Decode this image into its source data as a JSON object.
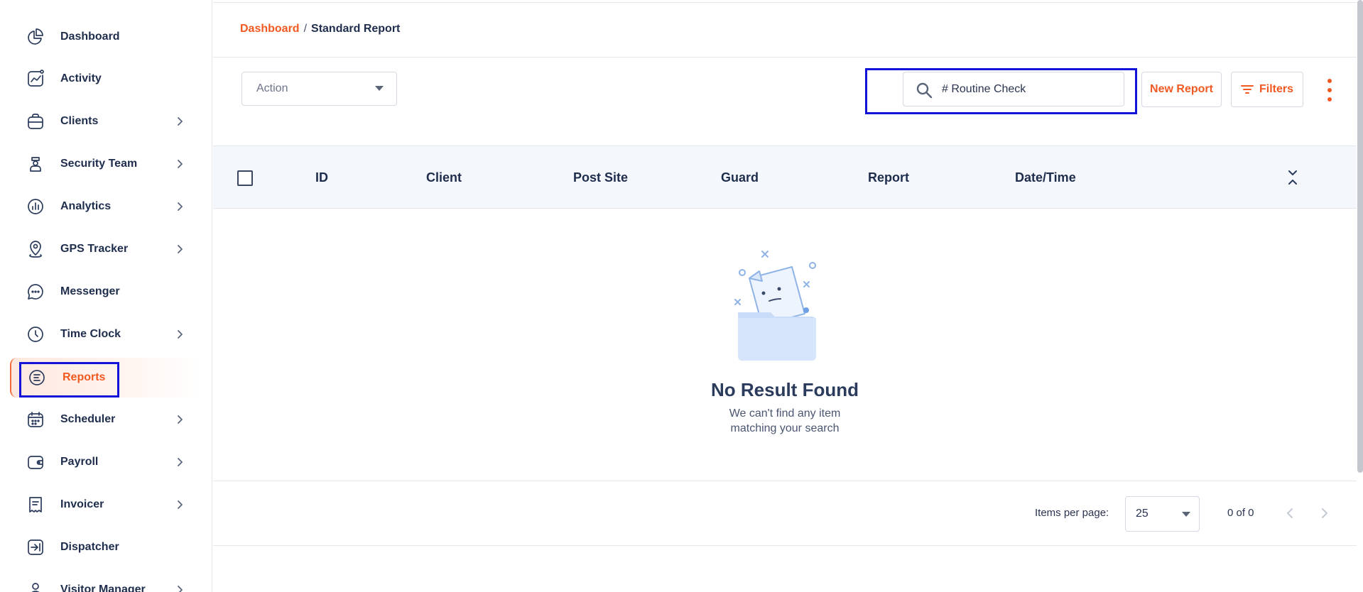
{
  "sidebar": {
    "items": [
      {
        "label": "Dashboard",
        "icon": "pie-chart-icon",
        "has_chevron": false
      },
      {
        "label": "Activity",
        "icon": "activity-icon",
        "has_chevron": false
      },
      {
        "label": "Clients",
        "icon": "briefcase-icon",
        "has_chevron": true
      },
      {
        "label": "Security Team",
        "icon": "guard-icon",
        "has_chevron": true
      },
      {
        "label": "Analytics",
        "icon": "analytics-icon",
        "has_chevron": true
      },
      {
        "label": "GPS Tracker",
        "icon": "map-pin-icon",
        "has_chevron": true
      },
      {
        "label": "Messenger",
        "icon": "chat-bubble-icon",
        "has_chevron": false
      },
      {
        "label": "Time Clock",
        "icon": "clock-icon",
        "has_chevron": true
      },
      {
        "label": "Reports",
        "icon": "report-icon",
        "has_chevron": false,
        "active": true
      },
      {
        "label": "Scheduler",
        "icon": "calendar-icon",
        "has_chevron": true
      },
      {
        "label": "Payroll",
        "icon": "wallet-icon",
        "has_chevron": true
      },
      {
        "label": "Invoicer",
        "icon": "receipt-icon",
        "has_chevron": true
      },
      {
        "label": "Dispatcher",
        "icon": "dispatch-icon",
        "has_chevron": false
      },
      {
        "label": "Visitor Manager",
        "icon": "visitor-icon",
        "has_chevron": true
      }
    ]
  },
  "breadcrumb": {
    "root": "Dashboard",
    "separator": "/",
    "current": "Standard Report"
  },
  "toolbar": {
    "action_placeholder": "Action",
    "search_value": "# Routine Check",
    "new_report_label": "New Report",
    "filters_label": "Filters"
  },
  "table": {
    "columns": [
      "ID",
      "Client",
      "Post Site",
      "Guard",
      "Report",
      "Date/Time"
    ],
    "rows": []
  },
  "empty_state": {
    "title": "No Result Found",
    "subtitle_line1": "We can't find any item",
    "subtitle_line2": "matching your search"
  },
  "pagination": {
    "items_per_page_label": "Items per page:",
    "items_per_page_value": "25",
    "range": "0 of 0"
  },
  "colors": {
    "accent": "#f05a22",
    "text": "#1f2d4d",
    "highlight_box": "#1212d8",
    "header_bg": "#f4f7fb"
  }
}
